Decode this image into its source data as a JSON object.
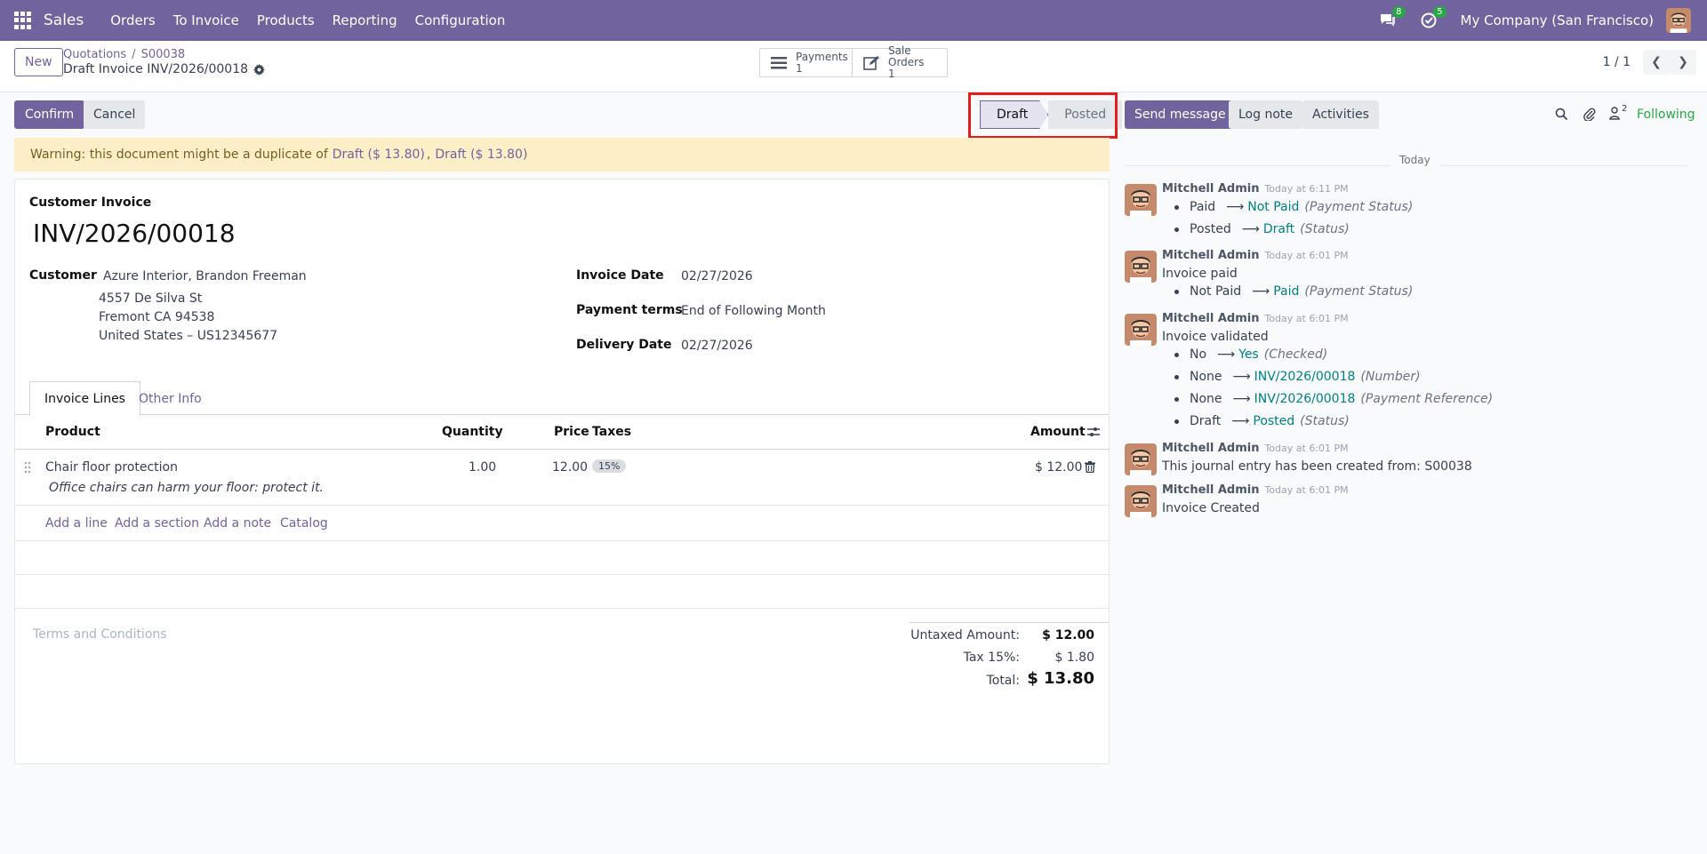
{
  "navbar": {
    "app_name": "Sales",
    "menu": [
      "Orders",
      "To Invoice",
      "Products",
      "Reporting",
      "Configuration"
    ],
    "messages_count": "8",
    "activities_count": "5",
    "company": "My Company (San Francisco)"
  },
  "control_panel": {
    "new_label": "New",
    "breadcrumb": [
      "Quotations",
      "S00038"
    ],
    "record_title": "Draft Invoice INV/2026/00018",
    "smart_buttons": [
      {
        "label": "Payments",
        "count": "1",
        "icon": "list-icon"
      },
      {
        "label": "Sale Orders",
        "count": "1",
        "icon": "edit-icon"
      }
    ],
    "pager": "1 / 1"
  },
  "actions": {
    "confirm_label": "Confirm",
    "cancel_label": "Cancel"
  },
  "status": {
    "stages": [
      "Draft",
      "Posted"
    ],
    "current": "Draft"
  },
  "warning": {
    "text": "Warning: this document might be a duplicate of",
    "links": [
      "Draft ($ 13.80)",
      "Draft ($ 13.80)"
    ]
  },
  "invoice": {
    "type": "Customer Invoice",
    "number": "INV/2026/00018",
    "customer_label": "Customer",
    "customer_name": "Azure Interior, Brandon Freeman",
    "customer_address": [
      "4557 De Silva St",
      "Fremont CA 94538",
      "United States – US12345677"
    ],
    "invoice_date_label": "Invoice Date",
    "invoice_date": "02/27/2026",
    "payment_terms_label": "Payment terms",
    "payment_terms": "End of Following Month",
    "delivery_date_label": "Delivery Date",
    "delivery_date": "02/27/2026"
  },
  "tabs": [
    "Invoice Lines",
    "Other Info"
  ],
  "lines": {
    "headers": {
      "product": "Product",
      "quantity": "Quantity",
      "price": "Price",
      "taxes": "Taxes",
      "amount": "Amount"
    },
    "rows": [
      {
        "product": "Chair floor protection",
        "description": "Office chairs can harm your floor: protect it.",
        "quantity": "1.00",
        "price": "12.00",
        "tax": "15%",
        "amount": "$ 12.00"
      }
    ],
    "add_actions": [
      "Add a line",
      "Add a section",
      "Add a note",
      "Catalog"
    ]
  },
  "terms_placeholder": "Terms and Conditions",
  "totals": {
    "untaxed_label": "Untaxed Amount:",
    "untaxed": "$ 12.00",
    "tax_label": "Tax 15%:",
    "tax": "$ 1.80",
    "total_label": "Total:",
    "total": "$ 13.80"
  },
  "chatter": {
    "send_message": "Send message",
    "log_note": "Log note",
    "activities": "Activities",
    "followers_count": "2",
    "following": "Following",
    "today": "Today",
    "messages": [
      {
        "author": "Mitchell Admin",
        "time": "Today at 6:11 PM",
        "body": "",
        "changes": [
          {
            "old": "Paid",
            "new": "Not Paid",
            "field": "(Payment Status)"
          },
          {
            "old": "Posted",
            "new": "Draft",
            "field": "(Status)"
          }
        ]
      },
      {
        "author": "Mitchell Admin",
        "time": "Today at 6:01 PM",
        "body": "Invoice paid",
        "changes": [
          {
            "old": "Not Paid",
            "new": "Paid",
            "field": "(Payment Status)"
          }
        ]
      },
      {
        "author": "Mitchell Admin",
        "time": "Today at 6:01 PM",
        "body": "Invoice validated",
        "changes": [
          {
            "old": "No",
            "new": "Yes",
            "field": "(Checked)"
          },
          {
            "old": "None",
            "new": "INV/2026/00018",
            "field": "(Number)"
          },
          {
            "old": "None",
            "new": "INV/2026/00018",
            "field": "(Payment Reference)"
          },
          {
            "old": "Draft",
            "new": "Posted",
            "field": "(Status)"
          }
        ]
      },
      {
        "author": "Mitchell Admin",
        "time": "Today at 6:01 PM",
        "body": "This journal entry has been created from: S00038",
        "changes": []
      },
      {
        "author": "Mitchell Admin",
        "time": "Today at 6:01 PM",
        "body": "Invoice Created",
        "changes": []
      }
    ]
  },
  "colors": {
    "brand": "#71639e",
    "link_teal": "#017e84",
    "warning_bg": "#fcefc7",
    "highlight": "#e41c1c"
  }
}
